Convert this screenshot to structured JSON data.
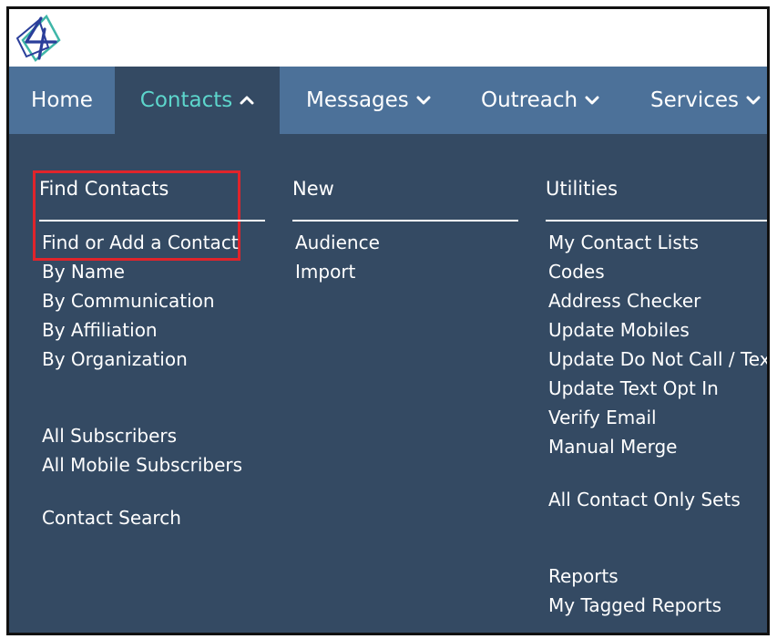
{
  "nav": {
    "home": "Home",
    "contacts": "Contacts",
    "messages": "Messages",
    "outreach": "Outreach",
    "services": "Services"
  },
  "menu": {
    "find_contacts": {
      "heading": "Find Contacts",
      "items": [
        "Find or Add a Contact",
        "By Name",
        "By Communication",
        "By Affiliation",
        "By Organization",
        "All Subscribers",
        "All Mobile Subscribers",
        "Contact Search"
      ]
    },
    "new": {
      "heading": "New",
      "items": [
        "Audience",
        "Import"
      ]
    },
    "utilities": {
      "heading": "Utilities",
      "items": [
        "My Contact Lists",
        "Codes",
        "Address Checker",
        "Update Mobiles",
        "Update Do Not Call / Text",
        "Update Text Opt In",
        "Verify Email",
        "Manual Merge",
        "All Contact Only Sets",
        "Reports",
        "My Tagged Reports"
      ]
    }
  },
  "colors": {
    "nav_bg": "#4c7199",
    "panel_bg": "#344a63",
    "active_text": "#5dd6cc",
    "highlight": "#e0242b"
  },
  "icons": {
    "logo": "logo-icon",
    "chevron_up": "chevron-up-icon",
    "chevron_down": "chevron-down-icon"
  }
}
